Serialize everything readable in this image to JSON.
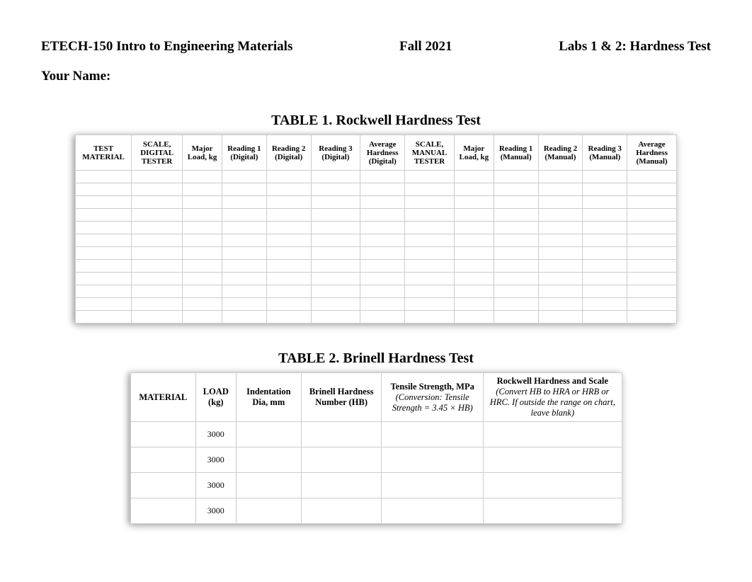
{
  "header": {
    "course": "ETECH-150 Intro to Engineering Materials",
    "term": "Fall 2021",
    "labs": "Labs 1 & 2: Hardness Test"
  },
  "name_label": "Your Name:",
  "table1": {
    "title": "TABLE 1. Rockwell Hardness Test",
    "headers": {
      "c1": "TEST MATERIAL",
      "c2": "SCALE, DIGITAL TESTER",
      "c3": "Major Load, kg",
      "c4a": "Reading 1",
      "c4b": "(Digital)",
      "c5a": "Reading 2",
      "c5b": "(Digital)",
      "c6a": "Reading 3",
      "c6b": "(Digital)",
      "c7a": "Average Hardness",
      "c7b": "(Digital)",
      "c8": "SCALE, MANUAL TESTER",
      "c9": "Major Load, kg",
      "c10a": "Reading 1",
      "c10b": "(Manual)",
      "c11a": "Reading 2",
      "c11b": "(Manual)",
      "c12a": "Reading 3",
      "c12b": "(Manual)",
      "c13a": "Average Hardness",
      "c13b": "(Manual)"
    },
    "rows": [
      {
        "c": [
          "",
          "",
          "",
          "",
          "",
          "",
          "",
          "",
          "",
          "",
          "",
          "",
          ""
        ]
      },
      {
        "c": [
          "",
          "",
          "",
          "",
          "",
          "",
          "",
          "",
          "",
          "",
          "",
          "",
          ""
        ]
      },
      {
        "c": [
          "",
          "",
          "",
          "",
          "",
          "",
          "",
          "",
          "",
          "",
          "",
          "",
          ""
        ]
      },
      {
        "c": [
          "",
          "",
          "",
          "",
          "",
          "",
          "",
          "",
          "",
          "",
          "",
          "",
          ""
        ]
      },
      {
        "c": [
          "",
          "",
          "",
          "",
          "",
          "",
          "",
          "",
          "",
          "",
          "",
          "",
          ""
        ]
      },
      {
        "c": [
          "",
          "",
          "",
          "",
          "",
          "",
          "",
          "",
          "",
          "",
          "",
          "",
          ""
        ]
      },
      {
        "c": [
          "",
          "",
          "",
          "",
          "",
          "",
          "",
          "",
          "",
          "",
          "",
          "",
          ""
        ]
      },
      {
        "c": [
          "",
          "",
          "",
          "",
          "",
          "",
          "",
          "",
          "",
          "",
          "",
          "",
          ""
        ]
      },
      {
        "c": [
          "",
          "",
          "",
          "",
          "",
          "",
          "",
          "",
          "",
          "",
          "",
          "",
          ""
        ]
      },
      {
        "c": [
          "",
          "",
          "",
          "",
          "",
          "",
          "",
          "",
          "",
          "",
          "",
          "",
          ""
        ]
      },
      {
        "c": [
          "",
          "",
          "",
          "",
          "",
          "",
          "",
          "",
          "",
          "",
          "",
          "",
          ""
        ]
      },
      {
        "c": [
          "",
          "",
          "",
          "",
          "",
          "",
          "",
          "",
          "",
          "",
          "",
          "",
          ""
        ]
      }
    ]
  },
  "table2": {
    "title": "TABLE 2. Brinell Hardness Test",
    "headers": {
      "c1": "MATERIAL",
      "c2": "LOAD (kg)",
      "c3": "Indentation Dia, mm",
      "c4": "Brinell Hardness Number (HB)",
      "c5a": "Tensile Strength, MPa",
      "c5b": "(Conversion: Tensile Strength = 3.45 × HB)",
      "c6a": "Rockwell Hardness and Scale",
      "c6b": "(Convert HB to HRA or HRB or HRC. If outside the range on chart, leave blank)"
    },
    "rows": [
      {
        "material": "",
        "load": "3000",
        "dia": "",
        "hb": "",
        "ts": "",
        "rh": ""
      },
      {
        "material": "",
        "load": "3000",
        "dia": "",
        "hb": "",
        "ts": "",
        "rh": ""
      },
      {
        "material": "",
        "load": "3000",
        "dia": "",
        "hb": "",
        "ts": "",
        "rh": ""
      },
      {
        "material": "",
        "load": "3000",
        "dia": "",
        "hb": "",
        "ts": "",
        "rh": ""
      }
    ]
  }
}
